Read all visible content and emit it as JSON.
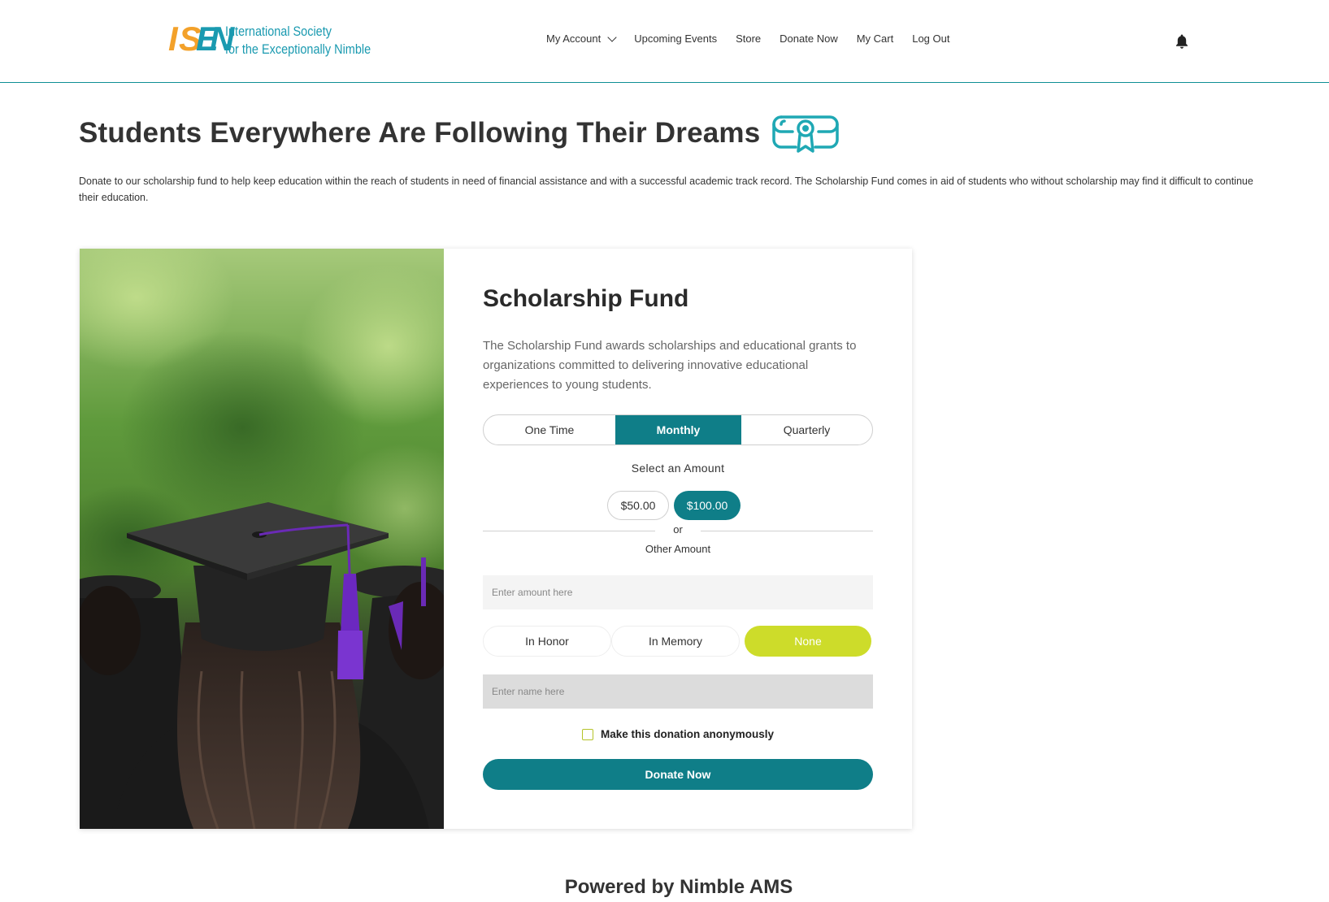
{
  "header": {
    "logo": {
      "mark_letters": [
        "I",
        "S",
        "E",
        "N"
      ],
      "line1": "International Society",
      "line2": "for the Exceptionally Nimble"
    },
    "nav": [
      {
        "label": "My Account",
        "has_dropdown": true
      },
      {
        "label": "Upcoming Events"
      },
      {
        "label": "Store"
      },
      {
        "label": "Donate Now"
      },
      {
        "label": "My Cart"
      },
      {
        "label": "Log Out"
      }
    ],
    "bell_icon": "bell-icon"
  },
  "page": {
    "title": "Students Everywhere Are Following Their Dreams",
    "title_icon": "diploma-icon",
    "intro": "Donate to our scholarship fund to help keep education within the reach of students in need of financial assistance and with a successful academic track record. The Scholarship Fund comes in aid of students who without scholarship may find it difficult to continue their education."
  },
  "donation": {
    "title": "Scholarship Fund",
    "description": "The Scholarship Fund awards scholarships and educational grants to organizations committed to delivering innovative educational experiences to young students.",
    "frequency": {
      "options": [
        "One Time",
        "Monthly",
        "Quarterly"
      ],
      "selected": "Monthly"
    },
    "amount": {
      "label": "Select an Amount",
      "options": [
        "$50.00",
        "$100.00"
      ],
      "selected": "$100.00",
      "or_text": "or",
      "other_label": "Other Amount",
      "other_placeholder": "Enter amount here",
      "other_value": ""
    },
    "tribute": {
      "options": [
        "In Honor",
        "In Memory",
        "None"
      ],
      "selected": "None",
      "name_placeholder": "Enter name here",
      "name_value": ""
    },
    "anonymous": {
      "label": "Make this donation anonymously",
      "checked": false
    },
    "submit_label": "Donate Now"
  },
  "footer": {
    "powered_by": "Powered by Nimble AMS"
  },
  "colors": {
    "teal": "#0f7e88",
    "header_rule": "#0e8f95",
    "lime": "#cddc2a",
    "logo_orange": "#f3a12a",
    "logo_cyan": "#1a9ab0"
  }
}
